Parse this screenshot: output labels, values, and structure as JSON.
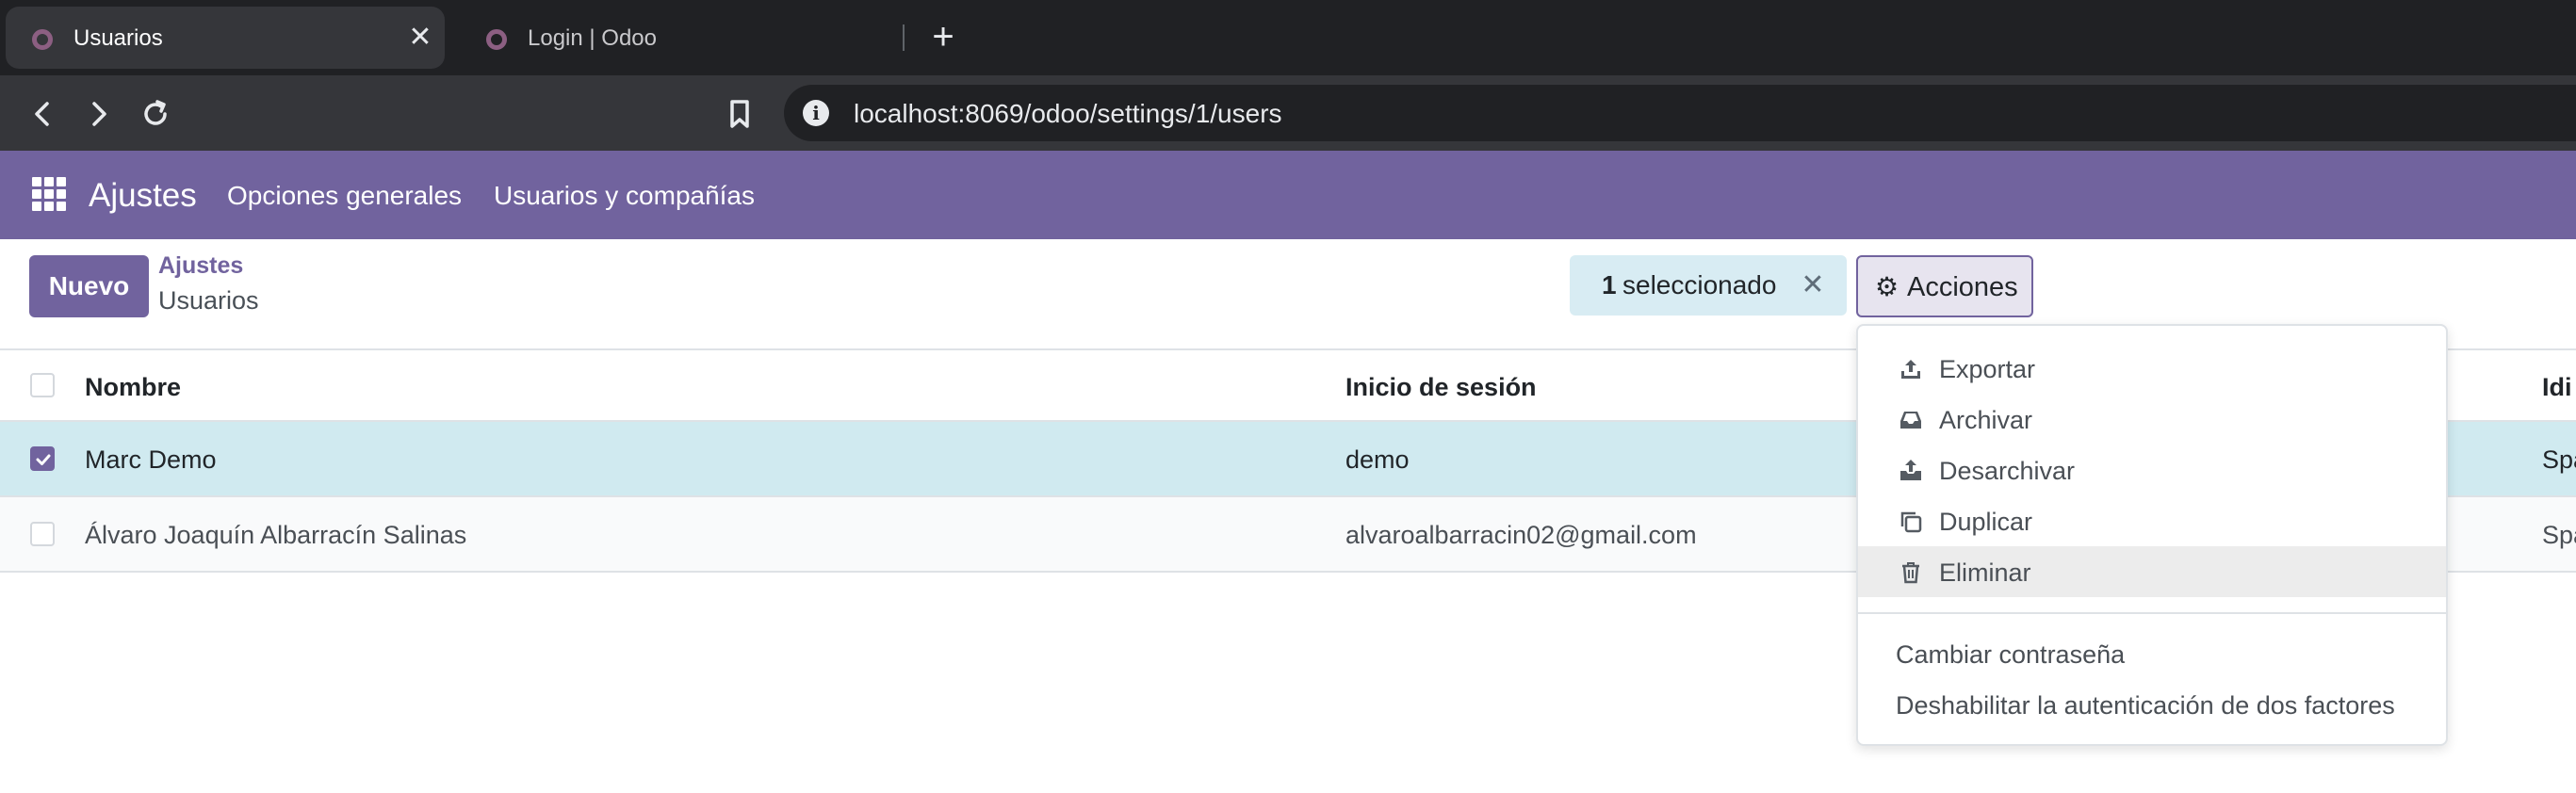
{
  "browser": {
    "tabs": [
      {
        "title": "Usuarios",
        "active": true
      },
      {
        "title": "Login | Odoo",
        "active": false
      }
    ],
    "url": "localhost:8069/odoo/settings/1/users",
    "colors": {
      "tabstrip": "#202124",
      "toolbar": "#35363a"
    }
  },
  "navbar": {
    "brand": "Ajustes",
    "menus": [
      "Opciones generales",
      "Usuarios y compañías"
    ],
    "color": "#71639e"
  },
  "control_panel": {
    "new_button": "Nuevo",
    "breadcrumb": {
      "parent": "Ajustes",
      "current": "Usuarios"
    },
    "selection": {
      "count": "1",
      "label": "seleccionado"
    },
    "actions_label": "Acciones"
  },
  "list": {
    "columns": [
      "Nombre",
      "Inicio de sesión",
      "Idi"
    ],
    "rows": [
      {
        "name": "Marc Demo",
        "login": "demo",
        "lang": "Spa",
        "selected": true
      },
      {
        "name": "Álvaro Joaquín Albarracín Salinas",
        "login": "alvaroalbarracin02@gmail.com",
        "lang": "Spa",
        "selected": false
      }
    ]
  },
  "actions_menu": {
    "items": [
      {
        "label": "Exportar",
        "icon": "upload-icon"
      },
      {
        "label": "Archivar",
        "icon": "inbox-icon"
      },
      {
        "label": "Desarchivar",
        "icon": "unarchive-icon"
      },
      {
        "label": "Duplicar",
        "icon": "copy-icon"
      },
      {
        "label": "Eliminar",
        "icon": "trash-icon",
        "hovered": true
      }
    ],
    "extra_items": [
      "Cambiar contraseña",
      "Deshabilitar la autenticación de dos factores"
    ]
  }
}
